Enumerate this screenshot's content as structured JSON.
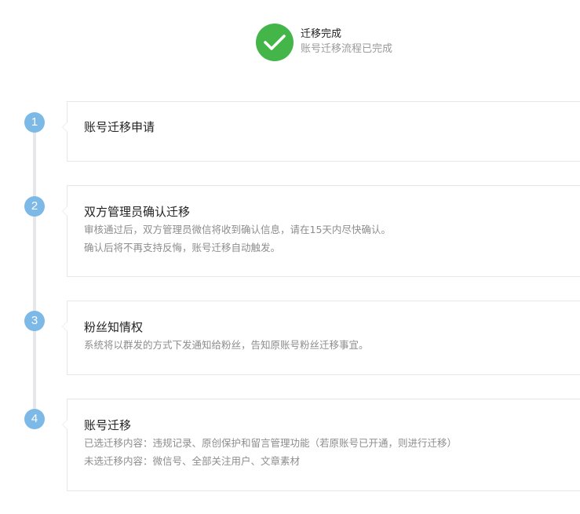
{
  "status": {
    "icon": "check-icon",
    "title": "迁移完成",
    "description": "账号迁移流程已完成",
    "color": "#44b549"
  },
  "timeline": {
    "accent_color": "#7db9e6",
    "steps": [
      {
        "number": "1",
        "title": "账号迁移申请",
        "lines": []
      },
      {
        "number": "2",
        "title": "双方管理员确认迁移",
        "lines": [
          "审核通过后，双方管理员微信将收到确认信息，请在15天内尽快确认。",
          "确认后将不再支持反悔，账号迁移自动触发。"
        ]
      },
      {
        "number": "3",
        "title": "粉丝知情权",
        "lines": [
          "系统将以群发的方式下发通知给粉丝，告知原账号粉丝迁移事宜。"
        ]
      },
      {
        "number": "4",
        "title": "账号迁移",
        "lines": [
          "已选迁移内容：违规记录、原创保护和留言管理功能（若原账号已开通，则进行迁移）",
          "未选迁移内容：微信号、全部关注用户、文章素材"
        ]
      }
    ]
  }
}
